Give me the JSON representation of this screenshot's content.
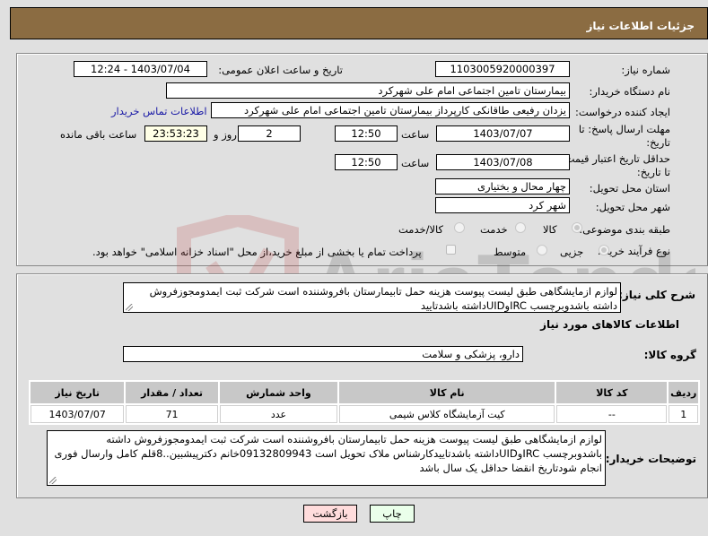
{
  "header": {
    "title": "جزئیات اطلاعات نیاز"
  },
  "form": {
    "need_number": {
      "label": "شماره نیاز:",
      "value": "1103005920000397"
    },
    "announce_datetime": {
      "label": "تاریخ و ساعت اعلان عمومی:",
      "value": "1403/07/04 - 12:24"
    },
    "buyer_org": {
      "label": "نام دستگاه خریدار:",
      "value": "بیمارستان تامین اجتماعی امام علی شهرکرد"
    },
    "requester": {
      "label": "ایجاد کننده درخواست:",
      "value": "یزدان رفیعی طاقانکی کارپرداز بیمارستان تامین اجتماعی امام علی شهرکرد"
    },
    "contact_link": "اطلاعات تماس خریدار",
    "reply_deadline": {
      "label": "مهلت ارسال پاسخ: تا تاریخ:",
      "date": "1403/07/07",
      "time_label": "ساعت",
      "time": "12:50",
      "days": "2",
      "days_label": "روز و",
      "remaining": "23:53:23",
      "remaining_label": "ساعت باقی مانده"
    },
    "price_validity": {
      "label": "حداقل تاریخ اعتبار قیمت: تا تاریخ:",
      "date": "1403/07/08",
      "time_label": "ساعت",
      "time": "12:50"
    },
    "province": {
      "label": "استان محل تحویل:",
      "value": "چهار محال و بختیاری"
    },
    "city": {
      "label": "شهر محل تحویل:",
      "value": "شهر کرد"
    },
    "category": {
      "label": "طبقه بندی موضوعی:",
      "options": [
        "کالا",
        "خدمت",
        "کالا/خدمت"
      ],
      "selected": "کالا"
    },
    "purchase_type": {
      "label": "نوع فرآیند خرید :",
      "options": [
        "جزیی",
        "متوسط"
      ],
      "selected": "جزیی",
      "treasury_note": "پرداخت تمام یا بخشی از مبلغ خرید،از محل \"اسناد خزانه اسلامی\" خواهد بود."
    }
  },
  "description": {
    "label": "شرح کلی نیاز:",
    "value": "لوازم ازمایشگاهی طبق لیست پیوست هزینه حمل تابیمارستان بافروشننده است شرکت ثبت ایمدومجوزفروش داشته باشدوبرچسب IRCوUIDداشته باشدتایید"
  },
  "items_section": {
    "title": "اطلاعات کالاهای مورد نیاز",
    "group_label": "گروه کالا:",
    "group_value": "دارو، پزشکی و سلامت",
    "columns": [
      "ردیف",
      "کد کالا",
      "نام کالا",
      "واحد شمارش",
      "تعداد / مقدار",
      "تاریخ نیاز"
    ],
    "rows": [
      {
        "row": "1",
        "code": "--",
        "name": "کیت آزمایشگاه کلاس شیمی",
        "unit": "عدد",
        "qty": "71",
        "date": "1403/07/07"
      }
    ]
  },
  "buyer_notes": {
    "label": "توضیحات خریدار:",
    "value": "لوازم ازمایشگاهی طبق لیست پیوست هزینه حمل تابیمارستان بافروشننده است شرکت ثبت ایمدومجوزفروش داشته باشدوبرچسب IRCوUIDداشته باشدتاییدکارشناس ملاک تحویل است 09132809943خانم دکترپیشبین..8قلم کامل وارسال فوری انجام شودتاریخ انقضا حداقل یک سال باشد"
  },
  "buttons": {
    "print": "چاپ",
    "back": "بازگشت"
  },
  "watermark": "AriaTender.net"
}
